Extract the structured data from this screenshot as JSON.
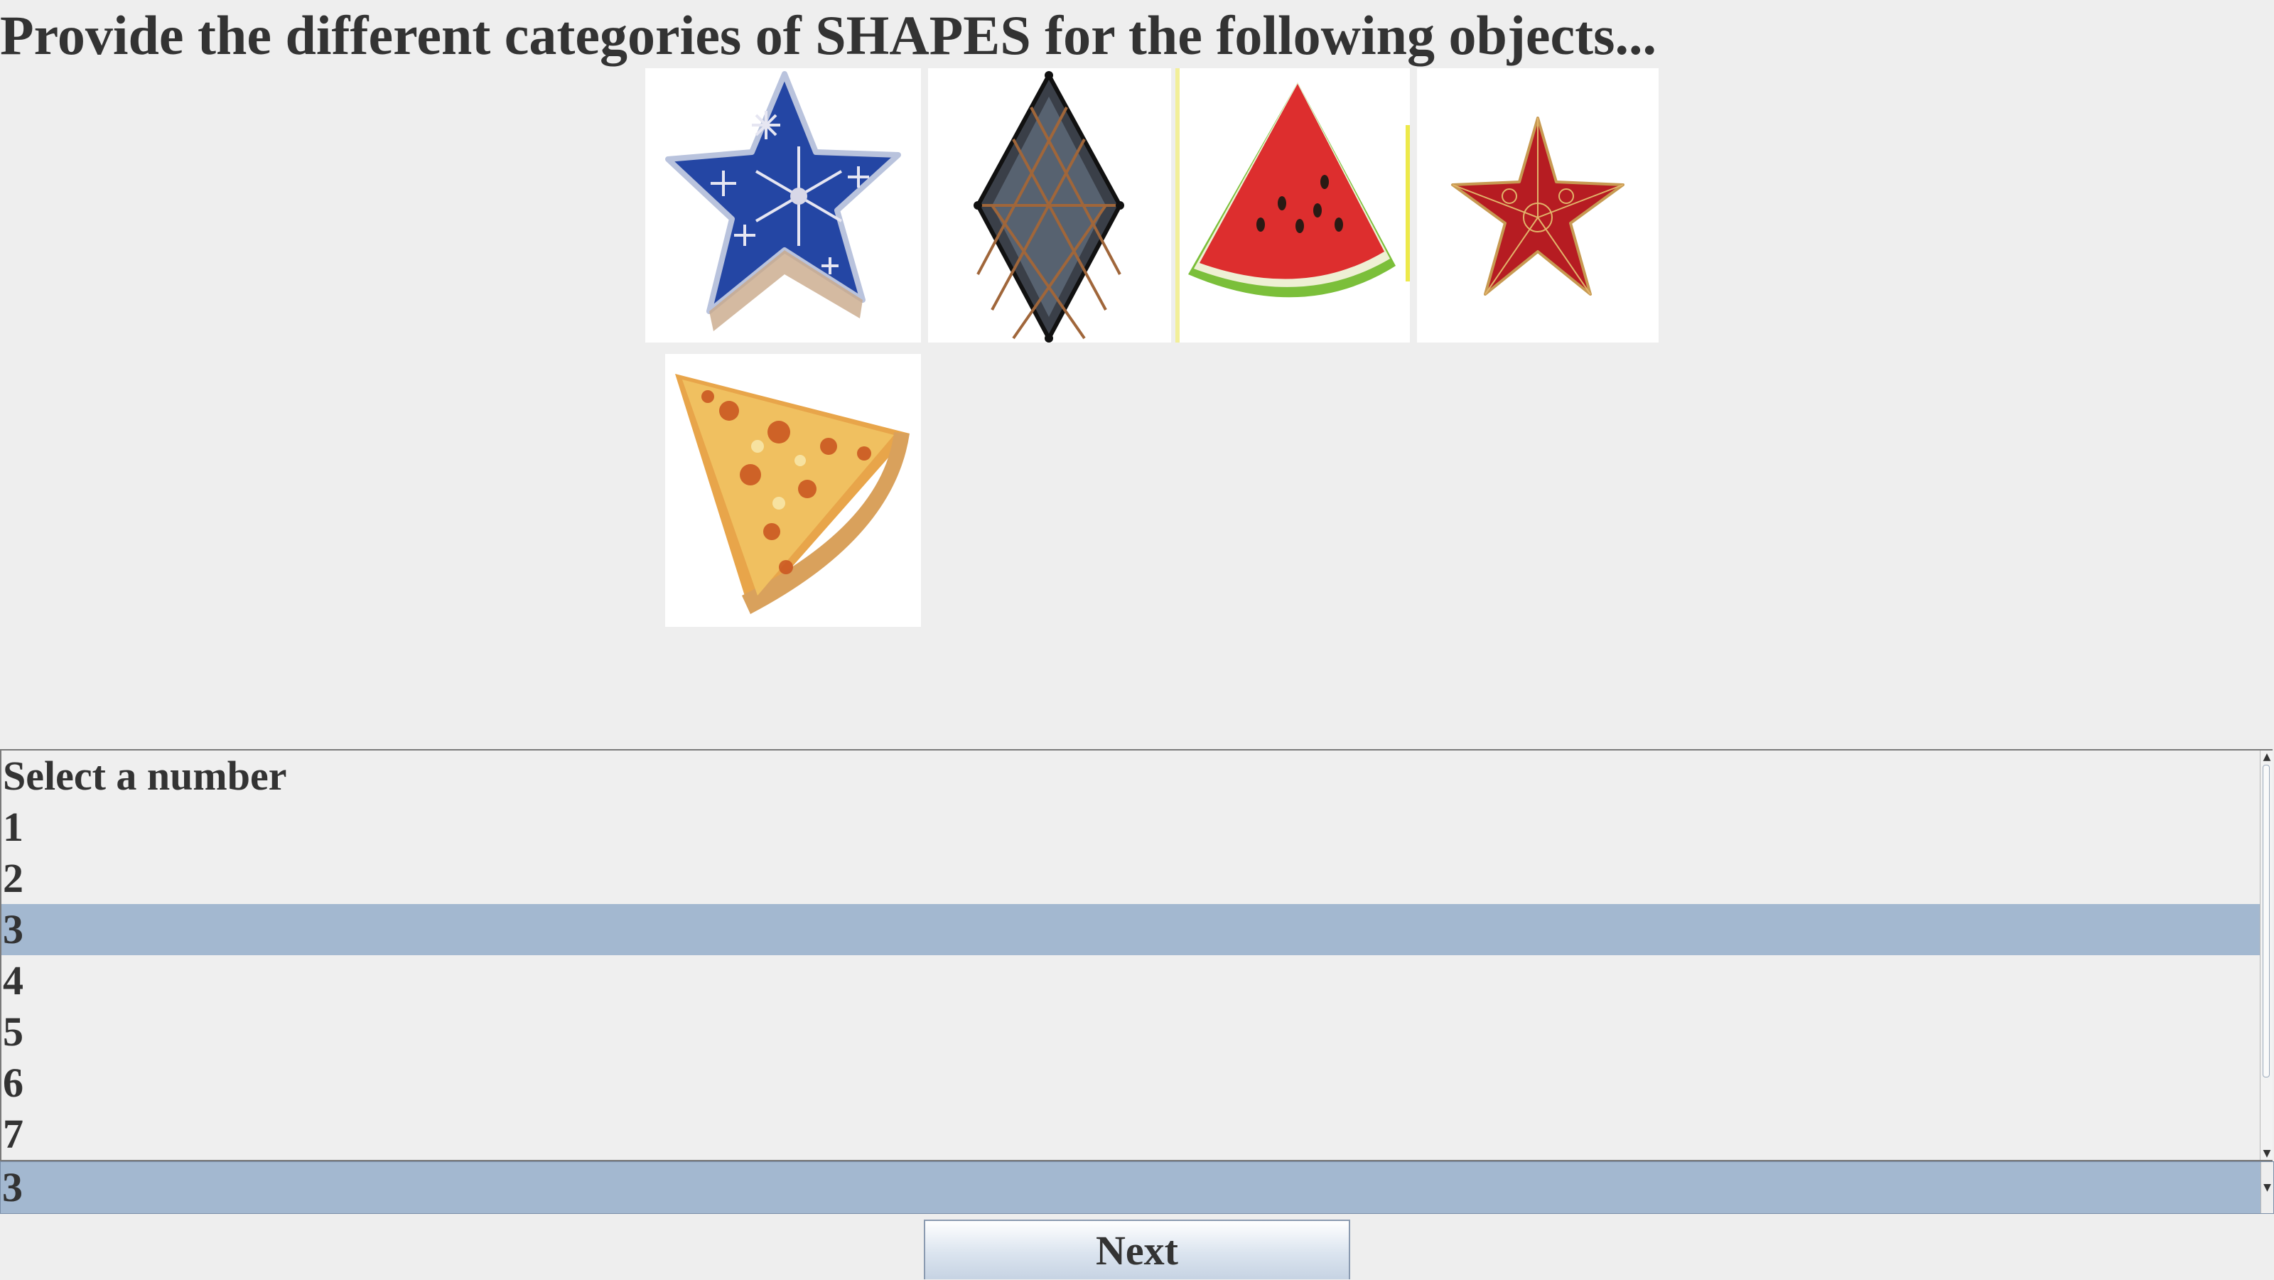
{
  "prompt": "Provide the different categories of SHAPES for the following objects...",
  "images": [
    {
      "name": "blue-star-box",
      "icon": "blue-star-image"
    },
    {
      "name": "diamond-mirror",
      "icon": "diamond-image"
    },
    {
      "name": "watermelon-slice",
      "icon": "watermelon-image"
    },
    {
      "name": "red-star",
      "icon": "red-star-image"
    },
    {
      "name": "pizza-slice",
      "icon": "pizza-image"
    }
  ],
  "list": {
    "items": [
      "Select a number",
      "1",
      "2",
      "3",
      "4",
      "5",
      "6",
      "7"
    ],
    "selected_index": 3
  },
  "combo": {
    "value": "3"
  },
  "next_label": "Next",
  "colors": {
    "selection": "#a3b8d0",
    "background": "#eeeeee"
  }
}
